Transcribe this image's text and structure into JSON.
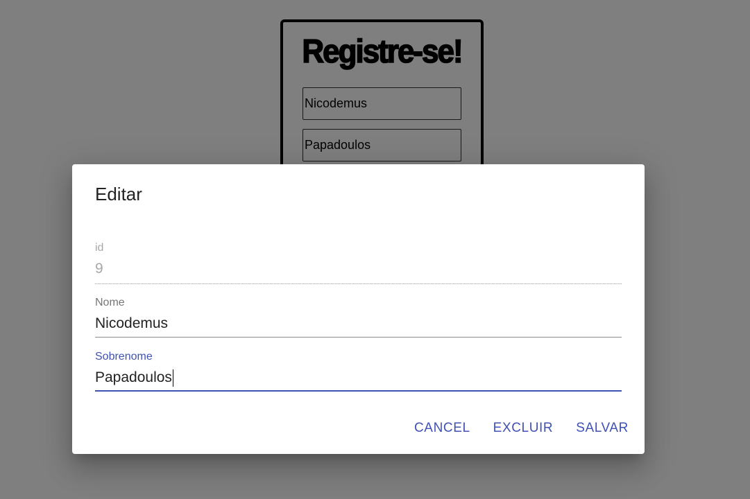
{
  "background": {
    "title": "Registre-se!",
    "inputs": [
      {
        "value": "Nicodemus"
      },
      {
        "value": "Papadoulos"
      }
    ]
  },
  "dialog": {
    "title": "Editar",
    "fields": {
      "id": {
        "label": "id",
        "value": "9",
        "disabled": true
      },
      "nome": {
        "label": "Nome",
        "value": "Nicodemus"
      },
      "sobrenome": {
        "label": "Sobrenome",
        "value": "Papadoulos",
        "focused": true
      }
    },
    "actions": {
      "cancel": "CANCEL",
      "excluir": "EXCLUIR",
      "salvar": "SALVAR"
    }
  },
  "colors": {
    "accent": "#3f51b5",
    "overlay": "rgba(0,0,0,0.5)",
    "text": "#222222",
    "muted": "#757575",
    "disabled": "#a8a8a8"
  }
}
